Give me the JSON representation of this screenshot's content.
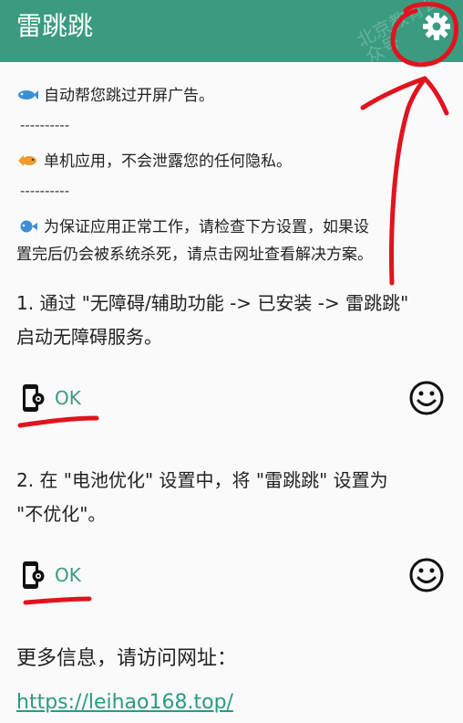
{
  "app": {
    "title": "雷跳跳",
    "watermark": "北京教育公众号"
  },
  "intro": {
    "line1": "自动帮您跳过开屏广告。",
    "separator1": "----------",
    "line2": "单机应用，不会泄露您的任何隐私。",
    "separator2": "----------",
    "line3_a": "为保证应用正常工作，请检查下方设置，如果设",
    "line3_b": "置完后仍会被系统杀死，请点击网址查看解决方案。"
  },
  "steps": [
    {
      "line_a": "1. 通过 \"无障碍/辅助功能 -> 已安装 -> 雷跳跳\"",
      "line_b": "启动无障碍服务。",
      "status": "OK"
    },
    {
      "line_a": "2. 在 \"电池优化\" 设置中，将 \"雷跳跳\" 设置为",
      "line_b": "\"不优化\"。",
      "status": "OK"
    }
  ],
  "more_info": {
    "label": "更多信息，请访问网址：",
    "url": "https://leihao168.top/"
  },
  "icons": {
    "settings": "gear-icon",
    "fish": "fish-icon",
    "goldfish": "goldfish-icon",
    "pufferfish": "pufferfish-icon",
    "phone_settings": "phone-settings-icon",
    "smiley": "smiley-icon"
  },
  "colors": {
    "appbar": "#3a9b80",
    "accent": "#3a9b80",
    "annotation": "#e0141e"
  }
}
